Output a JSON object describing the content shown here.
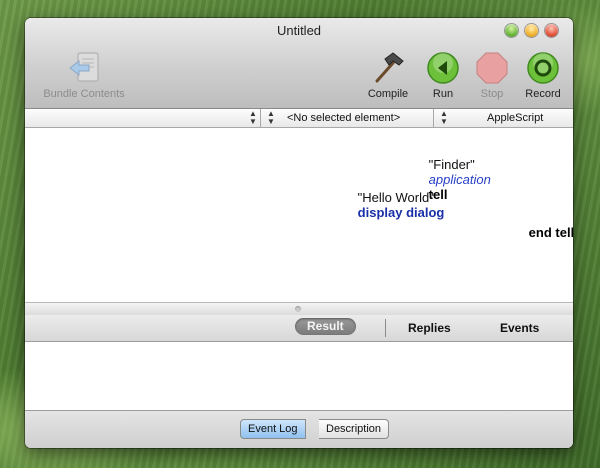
{
  "window": {
    "title": "Untitled"
  },
  "toolbar": {
    "bundle_label": "Bundle Contents",
    "compile_label": "Compile",
    "run_label": "Run",
    "stop_label": "Stop",
    "record_label": "Record"
  },
  "selectors": {
    "language": "AppleScript",
    "element": "<No selected element>"
  },
  "code": {
    "line1": {
      "keyword": "tell",
      "class": "application",
      "value": "\"Finder\""
    },
    "line2": {
      "keyword": "display dialog",
      "value": "\"Hello World\""
    },
    "line3": {
      "keyword": "end tell"
    }
  },
  "tabs": {
    "result": "Result",
    "replies": "Replies",
    "events": "Events"
  },
  "bottom": {
    "event_log": "Event Log",
    "description": "Description"
  },
  "icons": {
    "bundle": "bundle-contents-icon",
    "compile": "hammer-icon",
    "run": "run-play-icon",
    "stop": "stop-octagon-icon",
    "record": "record-circle-icon"
  },
  "colors": {
    "keyword_blue": "#1a2fa8",
    "class_blue": "#2740c8",
    "run_green": "#6cc03a",
    "stop_red": "#e08080"
  }
}
